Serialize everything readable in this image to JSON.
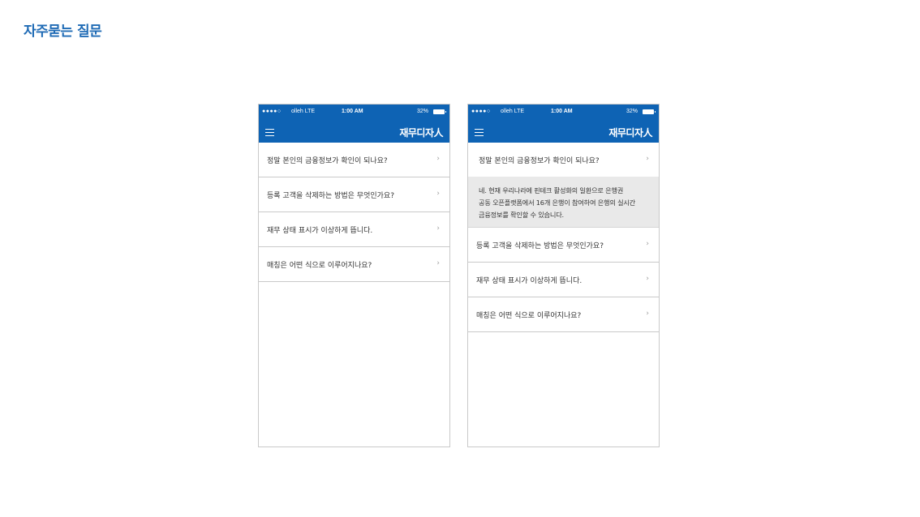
{
  "page": {
    "title": "자주묻는 질문"
  },
  "status_bar": {
    "signal": "●●●●○",
    "carrier": "olleh LTE",
    "time": "1:00 AM",
    "battery": "32%"
  },
  "app": {
    "logo": "재무디자人"
  },
  "chevron": "›",
  "faq": [
    {
      "question": "정말 본인의 금융정보가 확인이 되나요?"
    },
    {
      "question": "등록 고객을 삭제하는 방법은 무엇인가요?"
    },
    {
      "question": "재무 상태 표시가 이상하게 뜹니다."
    },
    {
      "question": "매칭은 어떤 식으로 이루어지나요?"
    }
  ],
  "answer": {
    "lines": [
      "네. 현재 우리나라에 핀테크 활성화의 일환으로 은행권",
      "공동 오픈플랫폼에서 16개 은행이 참여하여 은행의 실시간",
      "금융정보를 확인할 수 있습니다."
    ]
  }
}
